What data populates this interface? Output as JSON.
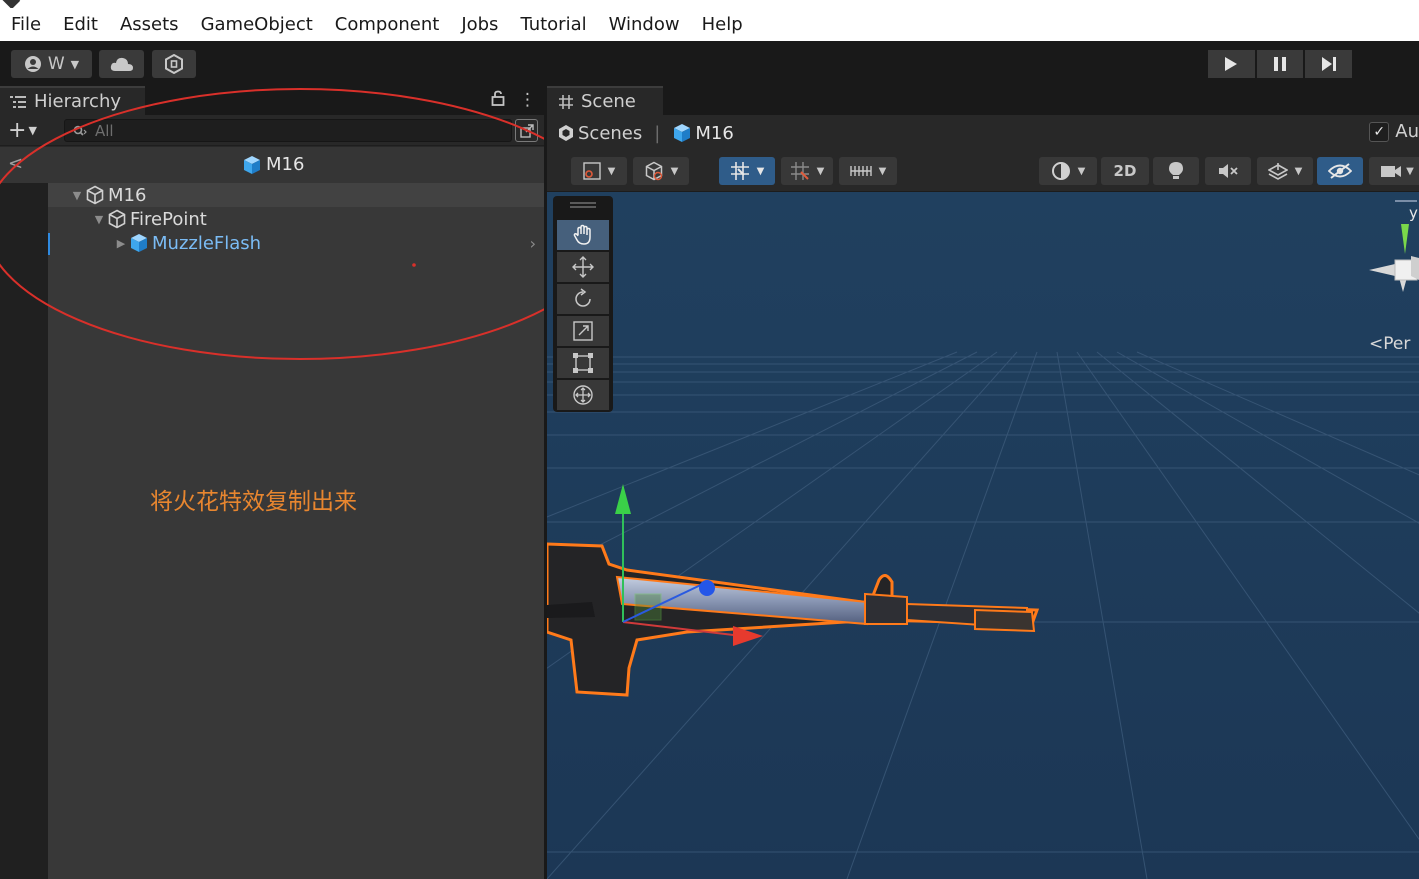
{
  "menu": [
    "File",
    "Edit",
    "Assets",
    "GameObject",
    "Component",
    "Jobs",
    "Tutorial",
    "Window",
    "Help"
  ],
  "toolbar": {
    "account_label": "W",
    "account_icon": "account-icon",
    "cloud_icon": "cloud-icon",
    "collab_icon": "collab-icon",
    "play_icon": "play-icon",
    "pause_icon": "pause-icon",
    "step_icon": "step-icon"
  },
  "hierarchy": {
    "tab_label": "Hierarchy",
    "search_placeholder": "All",
    "header_title": "M16",
    "tree": [
      {
        "label": "M16",
        "depth": 0,
        "expanded": true,
        "prefab": false
      },
      {
        "label": "FirePoint",
        "depth": 1,
        "expanded": true,
        "prefab": false
      },
      {
        "label": "MuzzleFlash",
        "depth": 2,
        "expanded": false,
        "prefab": true
      }
    ]
  },
  "annotation": {
    "note": "将火花特效复制出来",
    "color": "#e8862f",
    "ellipse_color": "#d9302a"
  },
  "scene": {
    "tab_label": "Scene",
    "breadcrumb_root": "Scenes",
    "breadcrumb_current": "M16",
    "auto_save_label": "Au",
    "btn_2d": "2D",
    "persp_label": "Per",
    "gizmo_axis_label": "y"
  },
  "colors": {
    "accent_blue": "#2f8ae0",
    "prefab_text": "#7bbcf5",
    "scene_bg": "#1f3a5a",
    "selection_outline": "#ff7a1a"
  }
}
